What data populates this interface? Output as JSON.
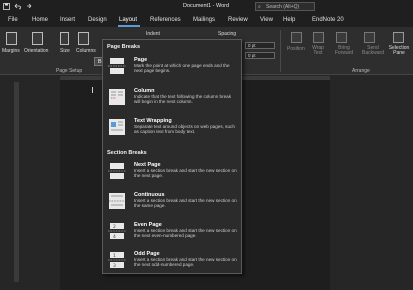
{
  "titlebar": {
    "title": "Document1 - Word",
    "search_placeholder": "Search (Alt+Q)"
  },
  "menu": {
    "items": [
      "File",
      "Home",
      "Insert",
      "Design",
      "Layout",
      "References",
      "Mailings",
      "Review",
      "View",
      "Help",
      "EndNote 20"
    ],
    "active": "Layout"
  },
  "ribbon": {
    "margins": "Margins",
    "orientation": "Orientation",
    "size": "Size",
    "columns": "Columns",
    "breaks": "Breaks",
    "indent": "Indent",
    "spacing": "Spacing",
    "indent_value": "0 pt",
    "spacing_value": "0 pt",
    "position": "Position",
    "wrap_text": "Wrap Text",
    "bring_forward": "Bring Forward",
    "send_backward": "Send Backward",
    "selection_pane": "Selection Pane",
    "group_page_setup": "Page Setup",
    "group_arrange": "Arrange"
  },
  "dropdown": {
    "page_breaks_header": "Page Breaks",
    "section_breaks_header": "Section Breaks",
    "items": [
      {
        "title": "Page",
        "desc": "Mark the point at which one page ends and the next page begins."
      },
      {
        "title": "Column",
        "desc": "Indicate that the text following the column break will begin in the next column."
      },
      {
        "title": "Text Wrapping",
        "desc": "Separate text around objects on web pages, such as caption text from body text."
      },
      {
        "title": "Next Page",
        "desc": "Insert a section break and start the new section on the next page."
      },
      {
        "title": "Continuous",
        "desc": "Insert a section break and start the new section on the same page."
      },
      {
        "title": "Even Page",
        "desc": "Insert a section break and start the new section on the next even-numbered page."
      },
      {
        "title": "Odd Page",
        "desc": "Insert a section break and start the new section on the next odd-numbered page."
      }
    ]
  }
}
